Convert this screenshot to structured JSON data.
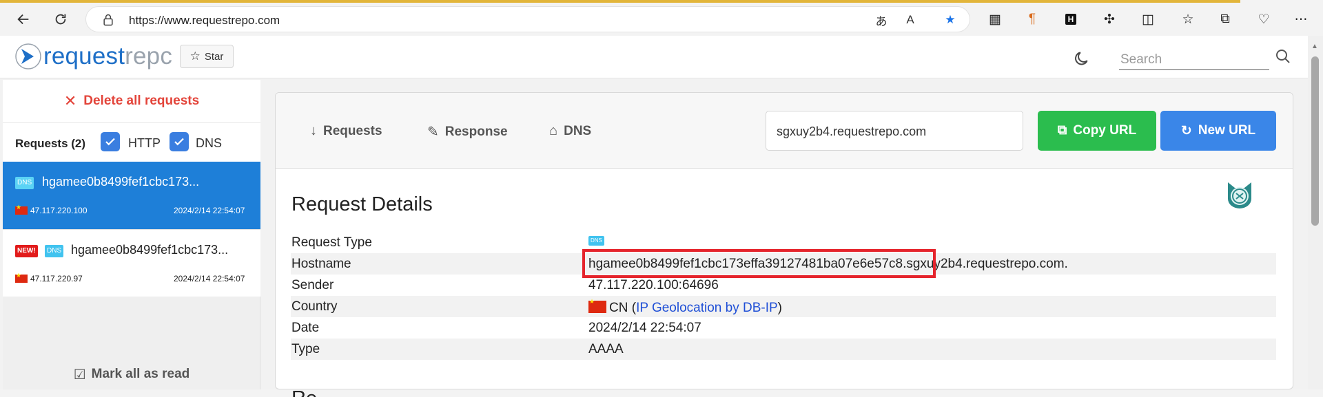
{
  "browser": {
    "url": "https://www.requestrepo.com",
    "toolbar_icons": [
      "translate-icon",
      "read-aloud-icon",
      "favorite-star-icon",
      "extension-icon",
      "paragraph-icon",
      "h-icon",
      "puzzle-icon",
      "split-screen-icon",
      "favorites-icon",
      "collections-icon",
      "health-icon",
      "more-icon"
    ]
  },
  "navbar": {
    "logo_part1": "request",
    "logo_part2": "repc",
    "star_label": "Star",
    "search_placeholder": "Search"
  },
  "sidebar": {
    "delete_all_label": "Delete all requests",
    "requests_label": "Requests (2)",
    "filter_http": "HTTP",
    "filter_dns": "DNS",
    "requests": [
      {
        "badge": "DNS",
        "host": "hgamee0b8499fef1cbc173...",
        "ip": "47.117.220.100",
        "datetime": "2024/2/14 22:54:07",
        "new": false
      },
      {
        "badge": "DNS",
        "new_badge": "NEW!",
        "host": "hgamee0b8499fef1cbc173...",
        "ip": "47.117.220.97",
        "datetime": "2024/2/14 22:54:07",
        "new": true
      }
    ],
    "mark_all_read_label": "Mark all as read"
  },
  "panel": {
    "tabs": [
      {
        "label": "Requests",
        "icon": "arrow-down-icon"
      },
      {
        "label": "Response",
        "icon": "pencil-icon"
      },
      {
        "label": "DNS",
        "icon": "home-icon"
      }
    ],
    "subdomain": "sgxuy2b4.requestrepo.com",
    "copy_url_label": "Copy URL",
    "new_url_label": "New URL"
  },
  "details": {
    "title": "Request Details",
    "rows": [
      {
        "key": "Request Type",
        "value": "DNS"
      },
      {
        "key": "Hostname",
        "value": "hgamee0b8499fef1cbc173effa39127481ba07e6e57c8.sgxuy2b4.requestrepo.com."
      },
      {
        "key": "Sender",
        "value": "47.117.220.100:64696"
      },
      {
        "key": "Country",
        "value_prefix": "CN (",
        "link": "IP Geolocation by DB-IP",
        "value_suffix": ")"
      },
      {
        "key": "Date",
        "value": "2024/2/14 22:54:07"
      },
      {
        "key": "Type",
        "value": "AAAA"
      }
    ],
    "response_heading": "Re"
  },
  "colors": {
    "accent_blue": "#1e7fd8",
    "copy_green": "#2bbd4e",
    "new_blue": "#3a86e8",
    "delete_red": "#e3443a",
    "highlight_red": "#e5242c"
  }
}
